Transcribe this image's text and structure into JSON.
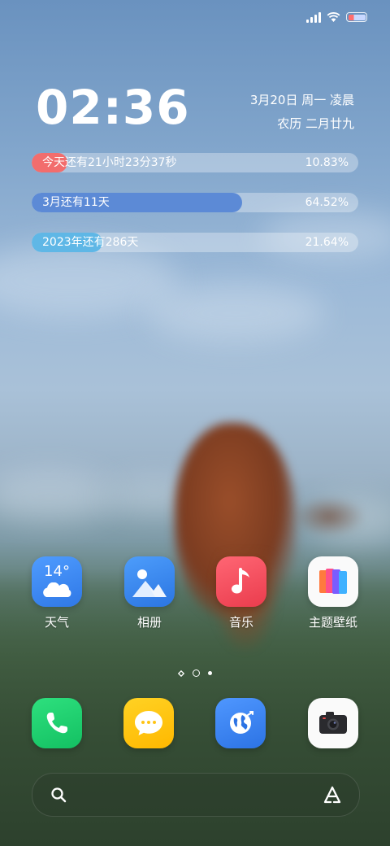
{
  "status_bar": {
    "icons": [
      "signal-icon",
      "wifi-icon",
      "battery-icon"
    ]
  },
  "clock_widget": {
    "time": "02:36",
    "date": "3月20日 周一 凌晨",
    "lunar": "农历 二月廿九"
  },
  "progress_widgets": [
    {
      "label": "今天还有21小时23分37秒",
      "percent": "10.83%",
      "fraction": 0.1083,
      "color": "#f26d6d"
    },
    {
      "label": "3月还有11天",
      "percent": "64.52%",
      "fraction": 0.6452,
      "color": "#5c8ad6"
    },
    {
      "label": "2023年还有286天",
      "percent": "21.64%",
      "fraction": 0.2164,
      "color": "#5fb7e6"
    }
  ],
  "apps": [
    {
      "label": "天气",
      "icon": "weather-icon",
      "icon_text": "14°"
    },
    {
      "label": "相册",
      "icon": "gallery-icon"
    },
    {
      "label": "音乐",
      "icon": "music-icon"
    },
    {
      "label": "主题壁纸",
      "icon": "themes-icon"
    }
  ],
  "page_indicator": {
    "pages": 3,
    "current": 2
  },
  "dock": [
    {
      "icon": "phone-icon"
    },
    {
      "icon": "messages-icon"
    },
    {
      "icon": "browser-icon"
    },
    {
      "icon": "camera-icon"
    }
  ],
  "search_bar": {
    "icons": [
      "search-icon",
      "ai-assistant-icon"
    ]
  },
  "colors": {
    "weather": "#3d8af0",
    "gallery": "#3b87ee",
    "music": "#f04e5c",
    "themes": "#ffffff",
    "phone": "#1fcf6b",
    "messages": "#ffc414",
    "browser": "#3f86ee",
    "camera": "#ffffff"
  }
}
